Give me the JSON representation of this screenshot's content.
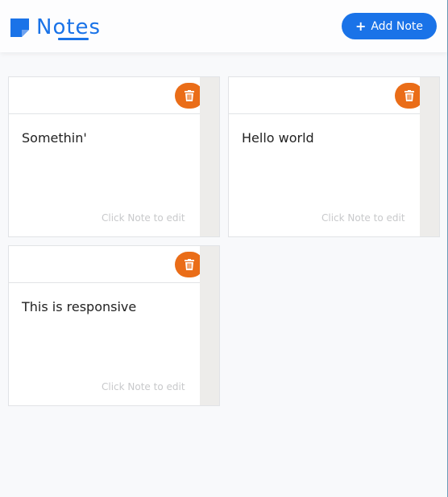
{
  "header": {
    "title": "Notes",
    "add_button_label": "Add Note",
    "brand_color": "#1a73e8",
    "logo_icon": "sticky-note-icon",
    "add_icon": "plus-icon"
  },
  "notes": [
    {
      "text": "Somethin'",
      "hint": "Click Note to edit"
    },
    {
      "text": "Hello world",
      "hint": "Click Note to edit"
    },
    {
      "text": "This is responsive",
      "hint": "Click Note to edit"
    }
  ],
  "colors": {
    "delete_button": "#ea6d18",
    "hint_text": "#c8c9cb"
  },
  "icons": {
    "delete": "trash-icon"
  }
}
